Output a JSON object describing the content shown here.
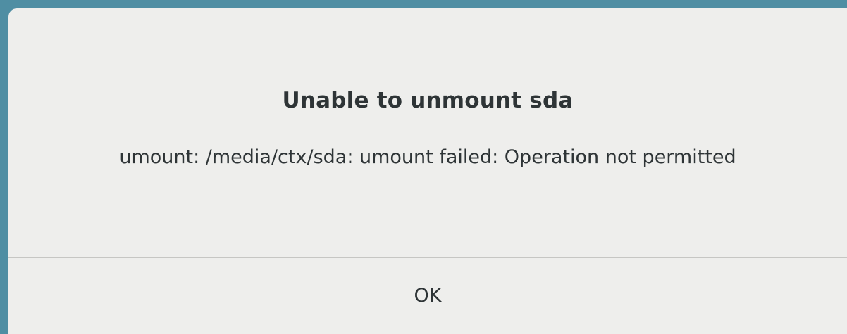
{
  "dialog": {
    "title": "Unable to unmount sda",
    "message": "umount: /media/ctx/sda: umount failed: Operation not permitted",
    "ok_label": "OK"
  },
  "colors": {
    "window_border": "#4f8ea3",
    "dialog_background": "#eeeeec",
    "text": "#2e3436",
    "separator": "#c6c6c3"
  }
}
